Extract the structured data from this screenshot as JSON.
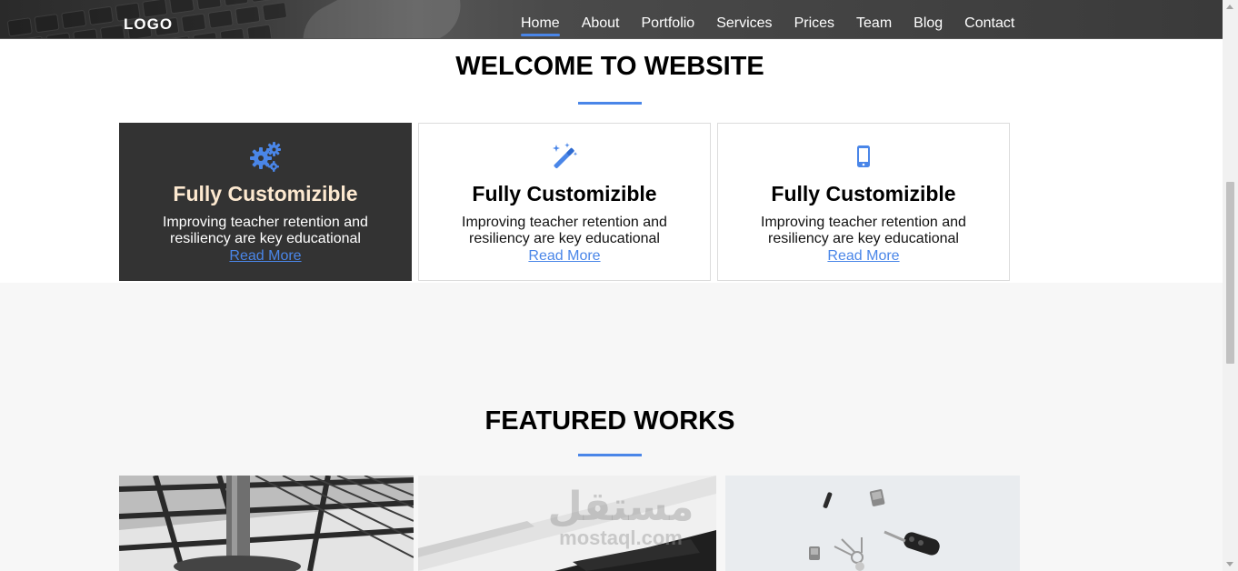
{
  "header": {
    "logo": "LOGO",
    "nav": [
      {
        "label": "Home",
        "active": true
      },
      {
        "label": "About"
      },
      {
        "label": "Portfolio"
      },
      {
        "label": "Services"
      },
      {
        "label": "Prices"
      },
      {
        "label": "Team"
      },
      {
        "label": "Blog"
      },
      {
        "label": "Contact"
      }
    ]
  },
  "welcome": {
    "title": "WELCOME TO WEBSITE",
    "cards": [
      {
        "icon": "gears-icon",
        "title": "Fully Customizible",
        "text": "Improving teacher retention and resiliency are key educational",
        "link": "Read More"
      },
      {
        "icon": "magic-wand-icon",
        "title": "Fully Customizible",
        "text": "Improving teacher retention and resiliency are key educational",
        "link": "Read More"
      },
      {
        "icon": "mobile-phone-icon",
        "title": "Fully Customizible",
        "text": "Improving teacher retention and resiliency are key educational",
        "link": "Read More"
      }
    ]
  },
  "featured": {
    "title": "FEATURED WORKS",
    "watermark": {
      "arabic": "مستقل",
      "latin": "mostaql.com"
    }
  },
  "colors": {
    "accent": "#4a86e8",
    "dark_card": "#333333",
    "featured_bg": "#f7f7f7"
  }
}
